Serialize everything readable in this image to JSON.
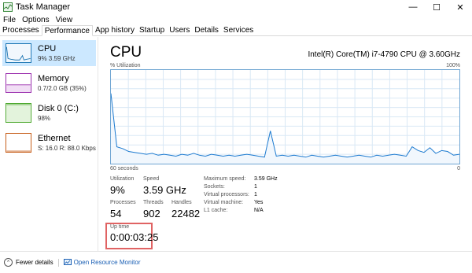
{
  "window": {
    "title": "Task Manager",
    "minimize_glyph": "—",
    "maximize_glyph": "☐",
    "close_glyph": "✕"
  },
  "menu": [
    "File",
    "Options",
    "View"
  ],
  "tabs": [
    {
      "label": "Processes",
      "active": false
    },
    {
      "label": "Performance",
      "active": true
    },
    {
      "label": "App history",
      "active": false
    },
    {
      "label": "Startup",
      "active": false
    },
    {
      "label": "Users",
      "active": false
    },
    {
      "label": "Details",
      "active": false
    },
    {
      "label": "Services",
      "active": false
    }
  ],
  "sidebar": {
    "items": [
      {
        "title": "CPU",
        "sub": "9% 3.59 GHz",
        "color": "#1f77b4",
        "selected": true
      },
      {
        "title": "Memory",
        "sub": "0.7/2.0 GB (35%)",
        "color": "#9b2fae",
        "selected": false
      },
      {
        "title": "Disk 0 (C:)",
        "sub": "98%",
        "color": "#4ca82d",
        "selected": false
      },
      {
        "title": "Ethernet",
        "sub": "S: 16.0 R: 88.0 Kbps",
        "color": "#c75f1c",
        "selected": false
      }
    ]
  },
  "main": {
    "title": "CPU",
    "cpu_name": "Intel(R) Core(TM) i7-4790 CPU @ 3.60GHz",
    "util_label": "% Utilization",
    "max_label": "100%",
    "time_label": "60 seconds",
    "min_label": "0",
    "graph_color": "#1c7ad0",
    "graph_series": [
      75,
      18,
      16,
      13,
      12,
      11,
      10,
      11,
      9,
      10,
      9,
      8,
      10,
      9,
      11,
      9,
      8,
      10,
      9,
      8,
      9,
      8,
      9,
      10,
      9,
      8,
      7,
      35,
      8,
      9,
      8,
      9,
      8,
      7,
      9,
      8,
      7,
      8,
      9,
      8,
      7,
      8,
      9,
      8,
      7,
      9,
      8,
      9,
      10,
      9,
      8,
      18,
      14,
      12,
      17,
      11,
      14,
      13,
      9,
      10
    ]
  },
  "stats": {
    "utilization_label": "Utilization",
    "utilization_value": "9%",
    "speed_label": "Speed",
    "speed_value": "3.59 GHz",
    "processes_label": "Processes",
    "processes_value": "54",
    "threads_label": "Threads",
    "threads_value": "902",
    "handles_label": "Handles",
    "handles_value": "22482",
    "uptime_label": "Up time",
    "uptime_value": "0:00:03:25"
  },
  "details": [
    {
      "label": "Maximum speed:",
      "value": "3.59 GHz"
    },
    {
      "label": "Sockets:",
      "value": "1"
    },
    {
      "label": "Virtual processors:",
      "value": "1"
    },
    {
      "label": "Virtual machine:",
      "value": "Yes"
    },
    {
      "label": "L1 cache:",
      "value": "N/A"
    }
  ],
  "statusbar": {
    "fewer_details": "Fewer details",
    "open_resource_monitor": "Open Resource Monitor"
  }
}
